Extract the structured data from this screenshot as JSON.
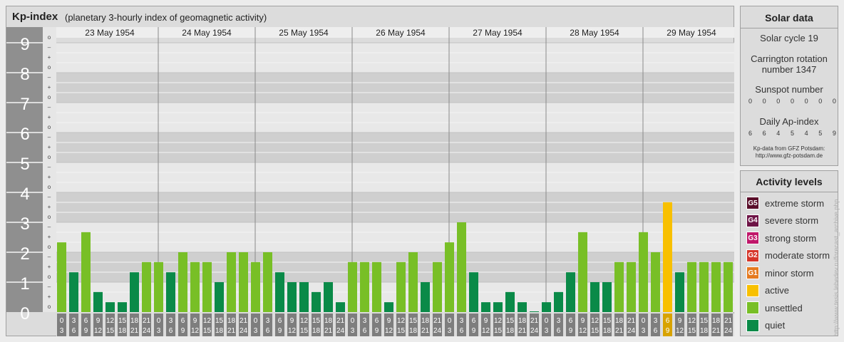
{
  "title": {
    "main": "Kp-index",
    "sub": "(planetary 3-hourly index of geomagnetic activity)"
  },
  "colors": {
    "quiet": "#0a8a48",
    "unsettled": "#78bf26",
    "active": "#f8c000",
    "g1": "#e57a20",
    "g2": "#d6362a",
    "g3": "#c0176a",
    "g4": "#6e1446",
    "g5": "#5a0e2a"
  },
  "chart_data": {
    "type": "bar",
    "ylabel": "",
    "xlabel": "",
    "ylim": [
      0,
      9
    ],
    "y_ticks": [
      "0",
      "1",
      "2",
      "3",
      "4",
      "5",
      "6",
      "7",
      "8",
      "9"
    ],
    "minor_ticks": [
      "o",
      "+",
      "–"
    ],
    "days": [
      "23 May 1954",
      "24 May 1954",
      "25 May 1954",
      "26 May 1954",
      "27 May 1954",
      "28 May 1954",
      "29 May 1954"
    ],
    "interval_top": [
      "0",
      "3",
      "6",
      "9",
      "12",
      "15",
      "18",
      "21"
    ],
    "interval_bottom": [
      "3",
      "6",
      "9",
      "12",
      "15",
      "18",
      "21",
      "24"
    ],
    "values": [
      [
        2.33,
        1.33,
        2.67,
        0.67,
        0.33,
        0.33,
        1.33,
        1.67
      ],
      [
        1.67,
        1.33,
        2.0,
        1.67,
        1.67,
        1.0,
        2.0,
        2.0
      ],
      [
        1.67,
        2.0,
        1.33,
        1.0,
        1.0,
        0.67,
        1.0,
        0.33
      ],
      [
        1.67,
        1.67,
        1.67,
        0.33,
        1.67,
        2.0,
        1.0,
        1.67
      ],
      [
        2.33,
        3.0,
        1.33,
        0.33,
        0.33,
        0.67,
        0.33,
        0.0
      ],
      [
        0.33,
        0.67,
        1.33,
        2.67,
        1.0,
        1.0,
        1.67,
        1.67
      ],
      [
        2.67,
        2.0,
        3.67,
        1.33,
        1.67,
        1.67,
        1.67,
        1.67
      ]
    ]
  },
  "solar": {
    "title": "Solar data",
    "cycle": "Solar cycle 19",
    "carrington_l1": "Carrington rotation",
    "carrington_l2": "number 1347",
    "sunspot_title": "Sunspot number",
    "sunspot_values": [
      "0",
      "0",
      "0",
      "0",
      "0",
      "0",
      "0"
    ],
    "ap_title": "Daily Ap-index",
    "ap_values": [
      "6",
      "6",
      "4",
      "5",
      "4",
      "5",
      "9"
    ],
    "credit_l1": "Kp-data from GFZ Potsdam:",
    "credit_l2": "http://www.gfz-potsdam.de"
  },
  "activity": {
    "title": "Activity levels",
    "items": [
      {
        "code": "G5",
        "label": "extreme storm",
        "color": "#5a0e2a"
      },
      {
        "code": "G4",
        "label": "severe storm",
        "color": "#6e1446"
      },
      {
        "code": "G3",
        "label": "strong storm",
        "color": "#c0176a"
      },
      {
        "code": "G2",
        "label": "moderate storm",
        "color": "#d6362a"
      },
      {
        "code": "G1",
        "label": "minor storm",
        "color": "#e57a20"
      },
      {
        "code": "",
        "label": "active",
        "color": "#f8c000"
      },
      {
        "code": "",
        "label": "unsettled",
        "color": "#78bf26"
      },
      {
        "code": "",
        "label": "quiet",
        "color": "#0a8a48"
      }
    ]
  },
  "watermark": "http://www.tesis.lebedev.ru/forecast_archive.php"
}
